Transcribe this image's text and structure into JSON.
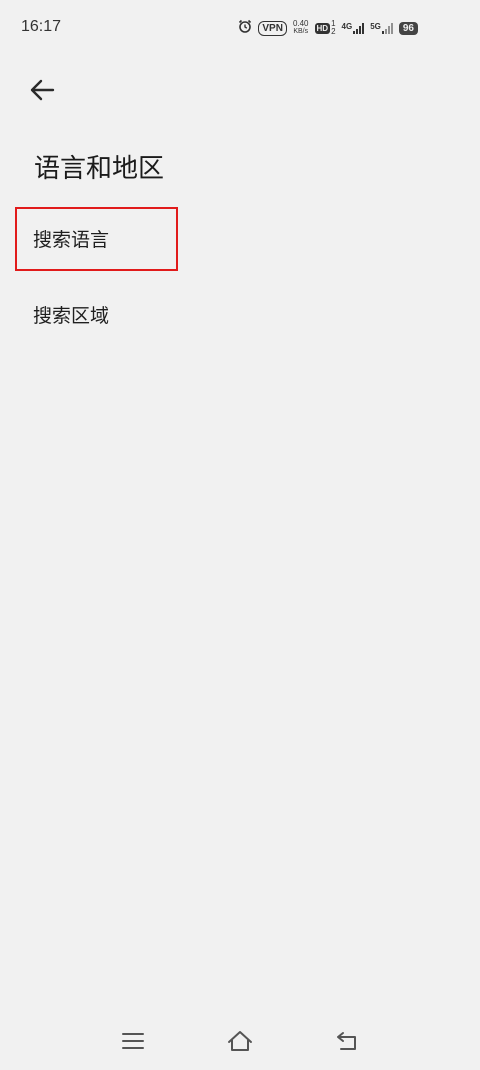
{
  "status_bar": {
    "time": "16:17",
    "vpn": "VPN",
    "speed_value": "0.40",
    "speed_unit": "KB/s",
    "hd_label": "HD",
    "hd_sub_top": "1",
    "hd_sub_bottom": "2",
    "network_1": "4G",
    "network_2": "5G",
    "battery": "96"
  },
  "header": {
    "back_icon": "arrow-left-icon",
    "title": "语言和地区"
  },
  "list": {
    "items": [
      {
        "label": "搜索语言"
      },
      {
        "label": "搜索区域"
      }
    ]
  },
  "nav_bar": {
    "menu_icon": "menu-icon",
    "home_icon": "home-icon",
    "back_icon": "back-icon"
  },
  "colors": {
    "background": "#f1f1f1",
    "highlight": "#e11b1b",
    "text": "#1f1f1f"
  }
}
